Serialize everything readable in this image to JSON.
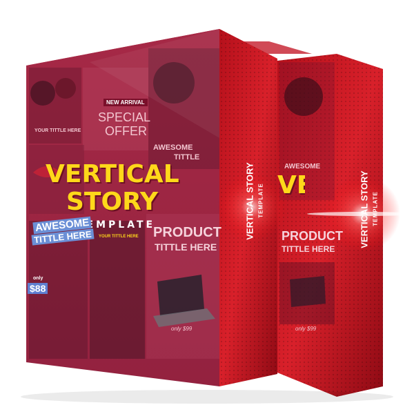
{
  "product": {
    "title_line1": "VERTICAL",
    "title_line2": "STORY",
    "subtitle": "TEMPLATE",
    "spine_title": "VERTICAL STORY",
    "spine_subtitle": "TEMPLATE"
  },
  "collage": {
    "new_arrival": "NEW ARRIVAL",
    "special_offer_1": "SPECIAL",
    "special_offer_2": "OFFER",
    "your_title": "YOUR TITTLE HERE",
    "awesome_1": "AWESOME",
    "awesome_2": "TITTLE HERE",
    "awesome_small_1": "AWESOME",
    "awesome_small_2": "TITTLE",
    "price_only": "only",
    "price_value": "$88",
    "product_1": "PRODUCT",
    "product_2": "TITTLE HERE",
    "only_price": "only $99",
    "small_title": "YOUR TITTLE HERE"
  },
  "colors": {
    "front": "#9e1c3f",
    "side": "#c4141e",
    "title_yellow": "#ffd81a"
  }
}
